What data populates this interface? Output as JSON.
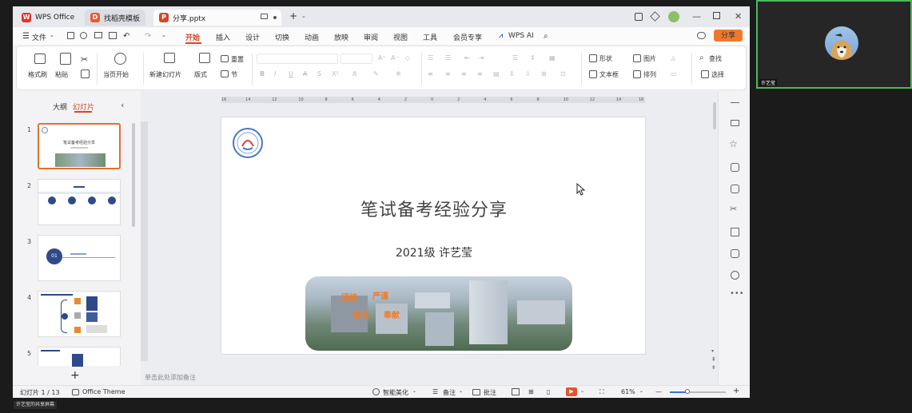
{
  "window": {
    "tabs": [
      {
        "label": "WPS Office",
        "icon": "wps-logo-icon"
      },
      {
        "label": "找稻壳模板",
        "icon": "docer-icon"
      },
      {
        "label": "分享.pptx",
        "icon": "ppt-file-icon"
      }
    ],
    "new_tab_symbol": "+"
  },
  "menu": {
    "file": "文件",
    "items": [
      "开始",
      "插入",
      "设计",
      "切换",
      "动画",
      "放映",
      "审阅",
      "视图",
      "工具",
      "会员专享"
    ],
    "active": "开始",
    "wps_ai": "WPS AI",
    "share": "分享"
  },
  "ribbon": {
    "format_painter": "格式刷",
    "paste": "粘贴",
    "play_from_current": "当页开始",
    "new_slide": "新建幻灯片",
    "layout": "版式",
    "section": "节",
    "reset": "重置",
    "shape": "形状",
    "picture": "图片",
    "textbox": "文本框",
    "arrange": "排列",
    "find": "查找",
    "select": "选择"
  },
  "left_panel": {
    "tab_outline": "大纲",
    "tab_slides": "幻灯片",
    "slide_numbers": [
      "1",
      "2",
      "3",
      "4",
      "5"
    ],
    "thumb1_title": "笔试备考经验分享",
    "thumb3_badge": "01",
    "add_symbol": "+"
  },
  "slide": {
    "title": "笔试备考经验分享",
    "subtitle": "2021级 许艺莹",
    "banner_words": [
      "团结",
      "严谨",
      "敬业",
      "奉献"
    ]
  },
  "ruler": {
    "ticks": [
      "16",
      "14",
      "12",
      "10",
      "8",
      "6",
      "4",
      "2",
      "0",
      "2",
      "4",
      "6",
      "8",
      "10",
      "12",
      "14",
      "16"
    ]
  },
  "notes_placeholder": "单击此处添加备注",
  "status": {
    "slide_counter": "幻灯片 1 / 13",
    "theme": "Office Theme",
    "smart_beautify": "智能美化",
    "notes": "备注",
    "comments": "批注",
    "zoom": "61%"
  },
  "screen_share_label": "许艺莹的共享屏幕",
  "participant": {
    "name": "许艺莹"
  },
  "colors": {
    "accent": "#d24726",
    "share": "#f0782c",
    "active_speaker": "#4bb85b"
  }
}
